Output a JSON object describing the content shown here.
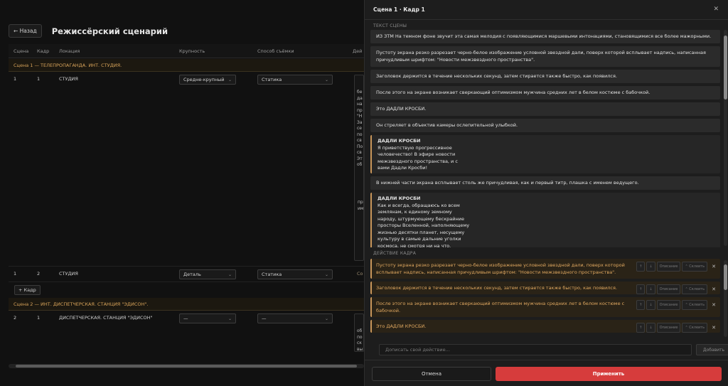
{
  "page": {
    "back_label": "← Назад",
    "title": "Режиссёрский сценарий",
    "columns": [
      "Сцена",
      "Кадр",
      "Локация",
      "Крупность",
      "Способ съёмки",
      "Дей"
    ],
    "scene1_header": "Сцена 1 — ТЕЛЕПРОПАГАНДА. ИНТ. СТУДИЯ.",
    "scene2_header": "Сцена 2 — ИНТ. ДИСПЕТЧЕРСКАЯ. СТАНЦИЯ \"ЭДИСОН\".",
    "rows": [
      {
        "scene": "1",
        "frame": "1",
        "location": "СТУДИЯ",
        "size": "Средне-крупный",
        "method": "Статика",
        "snippet_top": "Пу\nбе\nда\nна\nпр\n\"Н\nЗа\nсе\nпо\nсв\nПо\nсв\nЭт\nоб",
        "snippet_bottom": "В н\nпр\nим"
      },
      {
        "scene": "1",
        "frame": "2",
        "location": "СТУДИЯ",
        "size": "Деталь",
        "method": "Статика",
        "snippet_top": "Со"
      },
      {
        "scene": "2",
        "frame": "1",
        "location": "ДИСПЕТЧЕРСКАЯ. СТАНЦИЯ \"ЭДИСОН\"",
        "size": "—",
        "method": "—",
        "snippet_top": "В д\nоб\nпо\nск\nвы\nта\nэтс"
      }
    ],
    "add_frame_label": "+ Кадр"
  },
  "drawer": {
    "title": "Сцена 1 · Кадр 1",
    "scene_text_label": "ТЕКСТ СЦЕНЫ",
    "paragraphs": [
      {
        "text": "ИЗ ЗТМ На темном фоне звучит эта самая мелодия с появляющимися маршевыми интонациями, становящимися все более мажорными."
      },
      {
        "text": "Пустоту экрана резко разрезает черно-белое изображение условной звездной дали, поверх которой всплывает надпись, написанная причудливым шрифтом: \"Новости межзвездного пространства\"."
      },
      {
        "text": "Заголовок держится в течение нескольких секунд, затем стирается также быстро, как появился."
      },
      {
        "text": "После этого на экране возникает сверкающий оптимизмом мужчина средних лет в белом костюме с бабочкой."
      },
      {
        "text": "Это ДАДЛИ КРОСБИ."
      },
      {
        "text": "Он стреляет в объектив камеры ослепительной улыбкой."
      },
      {
        "speaker": "ДАДЛИ КРОСБИ",
        "text": "Я приветствую прогрессивное\nчеловечество! В эфире новости\nмежзвездного пространства, и с\nвами Дадли Кросби!"
      },
      {
        "text": "В нижней части экрана всплывает столь же причудливая, как и первый титр, плашка с именем ведущего."
      },
      {
        "speaker": "ДАДЛИ КРОСБИ",
        "text": "Как и всегда, обращаюсь ко всем\nземлянам, к единому земному\nнароду, штурмующему бескрайние\nпросторы Вселенной, наполняющему\nжизнью десятки планет, несущему\nкультуру в самые дальние уголки\nкосмоса, не смотря ни на что."
      }
    ],
    "action_label": "ДЕЙСТВИЕ КАДРА",
    "actions": [
      {
        "text": "Пустоту экрана резко разрезает черно-белое изображение условной звездной дали, поверх которой всплывает надпись, написанная причудливым шрифтом: \"Новости межзвездного пространства\"."
      },
      {
        "text": "Заголовок держится в течение нескольких секунд, затем стирается также быстро, как появился."
      },
      {
        "text": "После этого на экране возникает сверкающий оптимизмом мужчина средних лет в белом костюме с бабочкой."
      },
      {
        "text": "Это ДАДЛИ КРОСБИ."
      }
    ],
    "action_tools": {
      "up": "↑",
      "down": "↓",
      "describe": "Описание",
      "merge": "⌃ Склеить",
      "remove": "✕"
    },
    "add_placeholder": "Дописать свой действие...",
    "add_button": "Добавить",
    "cancel": "Отмена",
    "apply": "Применить",
    "close": "✕"
  }
}
